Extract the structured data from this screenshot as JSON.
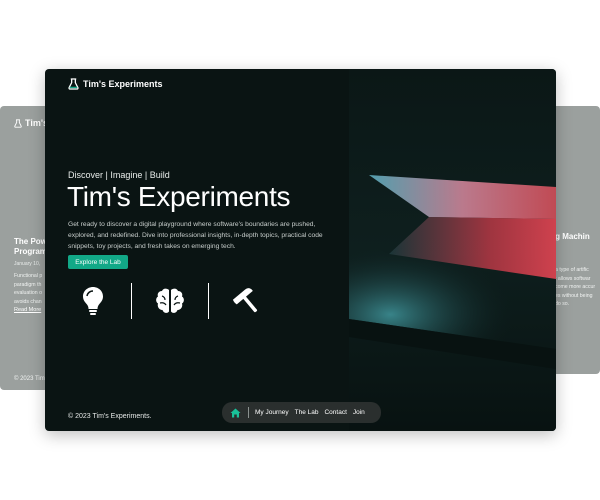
{
  "brand": {
    "name": "Tim's Experiments"
  },
  "hero": {
    "tagline": "Discover | Imagine | Build",
    "title": "Tim's Experiments",
    "description": "Get ready to discover a digital playground where software's boundaries are pushed, explored, and redefined. Dive into professional insights, in-depth topics, practical code snippets, toy projects, and fresh takes on emerging tech.",
    "cta": "Explore the Lab"
  },
  "features": {
    "icons": [
      "lightbulb-icon",
      "brain-icon",
      "hammer-icon"
    ]
  },
  "footer": {
    "copyright": "© 2023 Tim's Experiments."
  },
  "nav": {
    "home_icon": "home-icon",
    "links": [
      "My Journey",
      "The Lab",
      "Contact",
      "Join"
    ]
  },
  "bg_left": {
    "brand": "Tim's Experiments",
    "title_line1": "The Pow",
    "title_line2": "Program",
    "date": "January 10,",
    "text_lines": [
      "Functional p",
      "paradigm th",
      "evaluation o",
      "avoids chan"
    ],
    "read_more": "Read More",
    "footer": "© 2023 Tim"
  },
  "bg_right": {
    "title": "ing Machin",
    "text_lines": [
      "a type of artific",
      "t allows softwar",
      "come more accur",
      "es without being",
      "do so."
    ]
  },
  "colors": {
    "accent": "#12a887",
    "background": "#0a1413",
    "bg_card": "#9ba09e",
    "nav_bg": "#2a2f2e"
  }
}
